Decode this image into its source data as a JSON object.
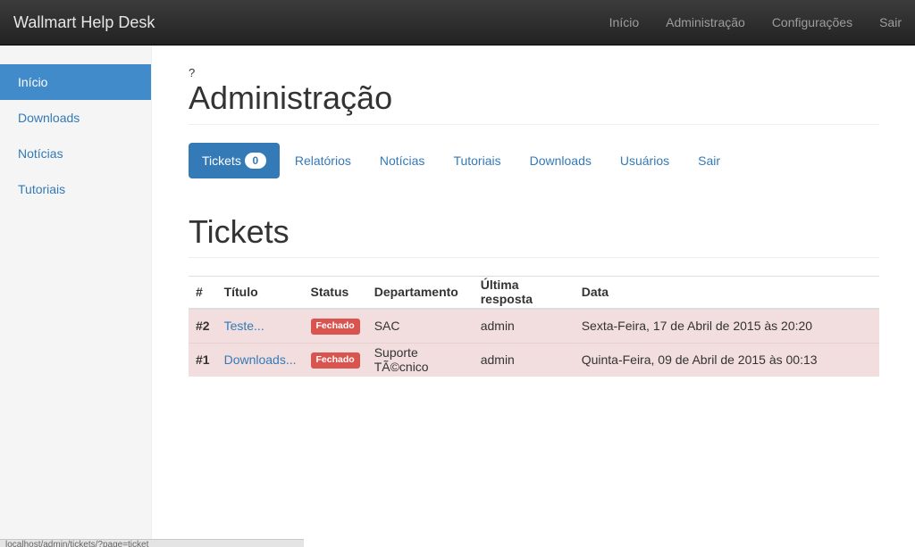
{
  "navbar": {
    "brand": "Wallmart Help Desk",
    "links": [
      "Início",
      "Administração",
      "Configurações",
      "Sair"
    ]
  },
  "sidebar": {
    "items": [
      {
        "label": "Início",
        "active": true
      },
      {
        "label": "Downloads",
        "active": false
      },
      {
        "label": "Notícias",
        "active": false
      },
      {
        "label": "Tutoriais",
        "active": false
      }
    ]
  },
  "main": {
    "question_mark": "?",
    "title": "Administração",
    "pills": {
      "tickets_label": "Tickets",
      "tickets_badge": "0",
      "others": [
        "Relatórios",
        "Notícias",
        "Tutoriais",
        "Downloads",
        "Usuários",
        "Sair"
      ]
    },
    "section_title": "Tickets",
    "table": {
      "headers": [
        "#",
        "Título",
        "Status",
        "Departamento",
        "Última resposta",
        "Data"
      ],
      "rows": [
        {
          "num": "#2",
          "title": "Teste...",
          "status": "Fechado",
          "department": "SAC",
          "last_reply": "admin",
          "date": "Sexta-Feira, 17 de Abril de 2015 às 20:20"
        },
        {
          "num": "#1",
          "title": "Downloads...",
          "status": "Fechado",
          "department": "Suporte TÃ©cnico",
          "last_reply": "admin",
          "date": "Quinta-Feira, 09 de Abril de 2015 às 00:13"
        }
      ]
    }
  },
  "statusbar": {
    "text": "localhost/admin/tickets/?page=ticket"
  },
  "colors": {
    "primary": "#337ab7",
    "danger": "#d9534f",
    "row_danger": "#f2dede",
    "navbar": "#222222"
  }
}
